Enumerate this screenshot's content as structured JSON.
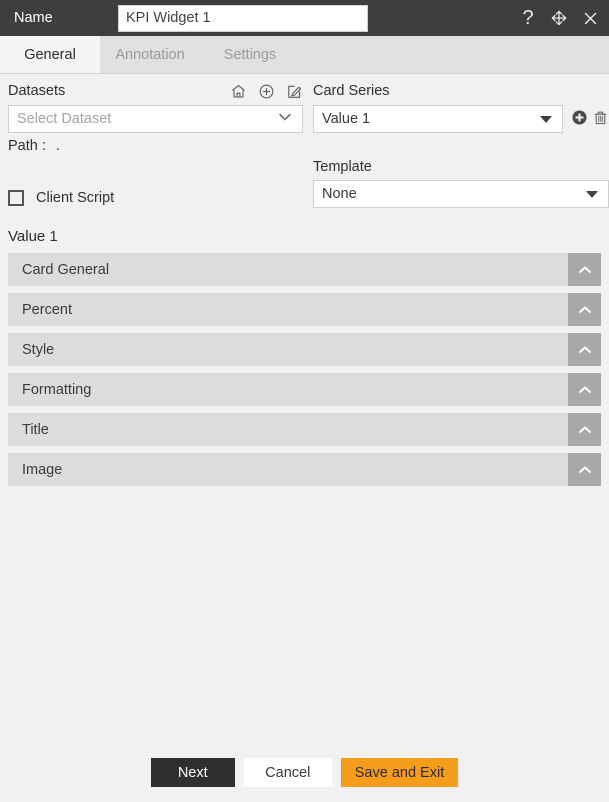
{
  "header": {
    "name_label": "Name",
    "name_value": "KPI Widget 1",
    "name_placeholder": "Name",
    "help_icon": "question-mark-icon",
    "move_icon": "move-arrows-icon",
    "close_icon": "close-x-icon"
  },
  "tabs": [
    {
      "label": "General",
      "active": true
    },
    {
      "label": "Annotation",
      "active": false
    },
    {
      "label": "Settings",
      "active": false
    }
  ],
  "datasets": {
    "label": "Datasets",
    "select_value": "",
    "select_placeholder": "Select Dataset",
    "icons": [
      "home-icon",
      "add-circle-icon",
      "edit-icon"
    ],
    "path_label": "Path :",
    "path_value": "."
  },
  "card_series": {
    "label": "Card Series",
    "select_value": "Value 1",
    "add_icon": "add-filled-circle-icon",
    "delete_icon": "trash-icon"
  },
  "client_script": {
    "label": "Client Script",
    "checked": false
  },
  "template": {
    "label": "Template",
    "select_value": "None"
  },
  "value_section": {
    "title": "Value 1",
    "sections": [
      {
        "label": "Card General",
        "toggle_icon": "chevron-up-icon"
      },
      {
        "label": "Percent",
        "toggle_icon": "chevron-up-icon"
      },
      {
        "label": "Style",
        "toggle_icon": "chevron-up-icon"
      },
      {
        "label": "Formatting",
        "toggle_icon": "chevron-up-icon"
      },
      {
        "label": "Title",
        "toggle_icon": "chevron-up-icon"
      },
      {
        "label": "Image",
        "toggle_icon": "chevron-up-icon"
      }
    ]
  },
  "footer": {
    "next_label": "Next",
    "cancel_label": "Cancel",
    "save_label": "Save and Exit"
  },
  "colors": {
    "header_bg": "#3e3e3e",
    "accent_orange": "#f59c1a",
    "accordion_bg": "#dcdcdc",
    "accordion_btn": "#a8a8a8",
    "page_bg": "#f1f1f1"
  }
}
